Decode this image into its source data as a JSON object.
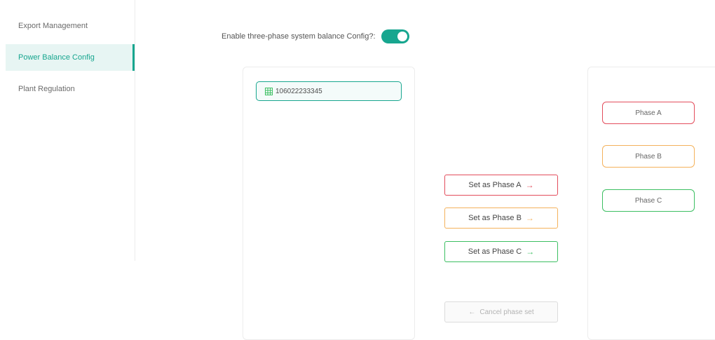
{
  "sidebar": {
    "items": [
      {
        "label": "Export Management"
      },
      {
        "label": "Power Balance Config"
      },
      {
        "label": "Plant Regulation"
      }
    ]
  },
  "balance": {
    "label": "Enable three-phase system balance Config?:",
    "enabled": true
  },
  "device": {
    "serial": "106022233345"
  },
  "actions": {
    "set_a": "Set as Phase A",
    "set_b": "Set as Phase B",
    "set_c": "Set as Phase C",
    "cancel": "Cancel phase set",
    "arrow_right": "→",
    "arrow_left": "←"
  },
  "phases": {
    "a": "Phase A",
    "b": "Phase B",
    "c": "Phase C"
  },
  "colors": {
    "accent": "#17a68f",
    "phase_a": "#e34d5c",
    "phase_b": "#f4b25c",
    "phase_c": "#3cbf62"
  }
}
